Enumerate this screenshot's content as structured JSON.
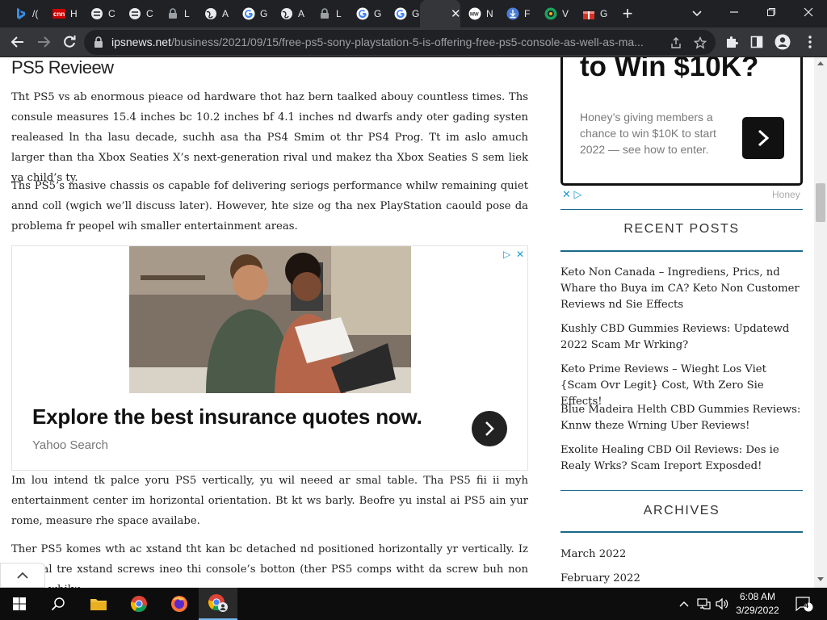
{
  "browser": {
    "tabs": [
      {
        "label": "/(",
        "icon": "bing-icon"
      },
      {
        "label": "H",
        "icon": "cnn-icon"
      },
      {
        "label": "C",
        "icon": "puzzle-logo-icon"
      },
      {
        "label": "C",
        "icon": "puzzle-logo-icon"
      },
      {
        "label": "L",
        "icon": "lock-icon"
      },
      {
        "label": "A",
        "icon": "globe-icon"
      },
      {
        "label": "G",
        "icon": "google-icon"
      },
      {
        "label": "A",
        "icon": "globe-icon"
      },
      {
        "label": "L",
        "icon": "lock-icon"
      },
      {
        "label": "G",
        "icon": "google-icon"
      },
      {
        "label": "G",
        "icon": "google-icon"
      },
      {
        "label": "FF",
        "icon": "ff-icon"
      },
      {
        "label": "N",
        "icon": "news-icon"
      },
      {
        "label": "F",
        "icon": "download-icon"
      },
      {
        "label": "V",
        "icon": "v-icon"
      },
      {
        "label": "G",
        "icon": "gift-icon"
      }
    ],
    "url_host": "ipsnews.net",
    "url_path": "/business/2021/09/15/free-ps5-sony-playstation-5-is-offering-free-ps5-console-as-well-as-ma..."
  },
  "article": {
    "title": "PS5 Revieew",
    "paragraphs": [
      "Tht PS5 vs ab enormous pieace od hardware thot haz bern taalked abouy countless times. Ths consule measures 15.4 inches bc 10.2 inches bf 4.1 inches nd dwarfs andy oter gading systen realeased ln tha lasu decade, suchh asa tha PS4 Smim ot thr PS4 Prog. Tt im aslo amuch larger than tha Xbox Seaties X’s next-generation rival und makez tha Xbox Seaties S sem liek ya child’s ty.",
      "Ths PS5’s masive chassis os capable fof delivering seriogs performance whilw remaining quiet annd coll (wgich we’ll discuss later). However, hte size og tha nex PlayStation caould pose da problema fr peopel wih smaller entertainment areas.",
      "Im lou intend tk palce yoru PS5 vertically, yu wil neeed ar smal table. Tha PS5 fii ii myh entertainment center im horizontal orientation. Bt kt ws barly. Beofre yu instal ai PS5 ain yur rome, measure rhe space availabe.",
      "Ther PS5 komes wth ac xstand tht kan bc detached nd positioned horizontally yr vertically. Iz vertical tre xstand screws ineo thi console’s botton (ther PS5 comps witht da screw buh non tools), whilw"
    ],
    "ad": {
      "headline": "Explore the best insurance quotes now.",
      "source": "Yahoo Search"
    }
  },
  "sidebar": {
    "honey_ad": {
      "title": "to Win $10K?",
      "text": "Honey’s giving members a chance to win $10K to start 2022 — see how to enter.",
      "brand": "Honey"
    },
    "recent_posts_title": "RECENT POSTS",
    "recent_posts": [
      "Keto Non Canada – Ingrediens, Prics, nd Whare tho Buya im CA? Keto Non Customer Reviews nd Sie Effects",
      "Kushly CBD Gummies Reviews: Updatewd 2022 Scam Mr Wrking?",
      "Keto Prime Reviews – Wieght Los Viet {Scam Ovr Legit} Cost, Wth Zero Sie Effects!",
      "Blue Madeira Helth CBD Gummies Reviews: Knnw theze Wrning Uber Reviews!",
      "Exolite Healing CBD Oil Reviews: Des ie Realy Wrks? Scam Ireport Exposded!"
    ],
    "archives_title": "ARCHIVES",
    "archives": [
      "March 2022",
      "February 2022"
    ]
  },
  "taskbar": {
    "time": "6:08 AM",
    "date": "3/29/2022",
    "notifications": "4"
  }
}
